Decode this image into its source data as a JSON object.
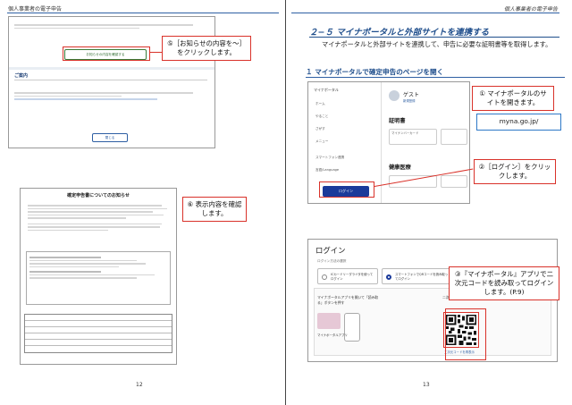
{
  "left_page": {
    "header": "個人事業者の電子申告",
    "page_number": "12",
    "top_shot": {
      "notice_button": "お知らせの内容を確認する",
      "guide_heading": "ご案内",
      "close_button": "閉じる"
    },
    "callout_5": "⑤［お知らせの内容を〜］をクリックします。",
    "bottom_doc": {
      "title": "確定申告書についてのお知らせ"
    },
    "callout_6": "⑥ 表示内容を確認します。"
  },
  "right_page": {
    "header": "個人事業者の電子申告",
    "page_number": "13",
    "section_title": "２−５ マイナポータルと外部サイトを連携する",
    "section_desc": "マイナポータルと外部サイトを連携して、申告に必要な証明書等を取得します。",
    "subheading": "１ マイナポータルで確定申告のページを開く",
    "portal": {
      "brand": "マイナポータル",
      "menu": [
        "ホーム",
        "やること",
        "さがす",
        "メニュー",
        "スマートフォン連携",
        "言語/Language"
      ],
      "login_button": "ログイン",
      "guest": "ゲスト",
      "guest_sub": "新規登録",
      "certs_label": "証明書",
      "card_label": "マイナンバーカード",
      "health_label": "健康医療"
    },
    "callout_1": "① マイナポータルのサイトを開きます。",
    "url": "myna.go.jp/",
    "callout_2": "②［ログイン］をクリックします。",
    "login_shot": {
      "title": "ログイン",
      "sub": "ログイン方法の選択",
      "option_pc": "ICカードリーダライタを使ってログイン",
      "option_sp": "スマートフォンでQRコードを読み取ってログイン",
      "step1": "マイナポータルアプリを開いて「読み取る」ボタンを押す",
      "step2": "二次元コードを読み取る",
      "card_caption": "マイナポータルアプリ",
      "qr_caption": "二次元コードを再表示"
    },
    "callout_3": "③『マイナポータル』アプリで二次元コードを読み取ってログインします。(P.9)"
  }
}
